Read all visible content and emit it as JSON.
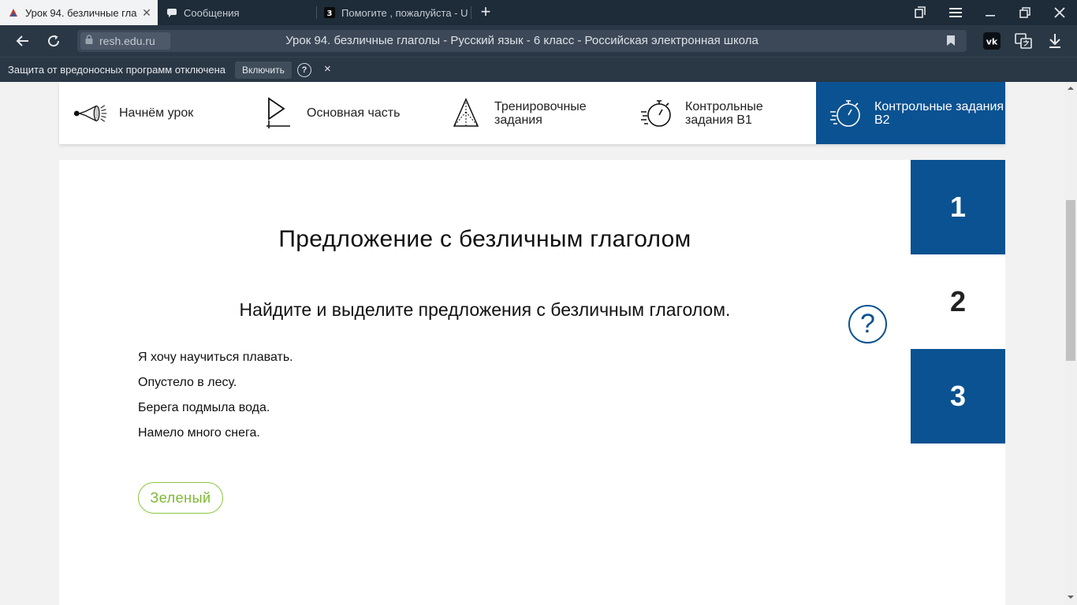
{
  "browser": {
    "tabs": [
      {
        "title": "Урок 94. безличные гла",
        "active": true,
        "icon": "resh-favicon"
      },
      {
        "title": "Сообщения",
        "active": false,
        "icon": "chat-bubble-icon"
      },
      {
        "title": "Помогите , пожалуйста - U",
        "active": false,
        "icon": "znanija-favicon"
      }
    ],
    "address": {
      "domain": "resh.edu.ru",
      "page_title": "Урок 94. безличные глаголы - Русский язык - 6 класс - Российская электронная школа"
    },
    "infobar": {
      "message": "Защита от вредоносных программ отключена",
      "button_label": "Включить",
      "help_glyph": "?",
      "close_glyph": "×"
    }
  },
  "lesson_nav": {
    "items": [
      {
        "label": "Начнём урок",
        "icon": "megaphone-icon",
        "active": false
      },
      {
        "label": "Основная часть",
        "icon": "play-icon",
        "active": false
      },
      {
        "label": "Тренировочные задания",
        "icon": "pyramid-icon",
        "active": false
      },
      {
        "label": "Контрольные задания В1",
        "icon": "stopwatch-icon",
        "active": false
      },
      {
        "label": "Контрольные задания В2",
        "icon": "stopwatch-icon",
        "active": true
      }
    ]
  },
  "task": {
    "title": "Предложение с безличным глаголом",
    "instruction": "Найдите и выделите предложения с безличным глаголом.",
    "help_glyph": "?",
    "sentences": [
      "Я хочу научиться плавать.",
      "Опустело в лесу.",
      "Берега подмыла вода.",
      "Намело много снега."
    ],
    "answer_chip": "Зеленый"
  },
  "task_tabs": [
    {
      "label": "1",
      "state": "done"
    },
    {
      "label": "2",
      "state": "current"
    },
    {
      "label": "3",
      "state": "done"
    }
  ],
  "colors": {
    "brand_blue": "#0a5291",
    "chip_green": "#8cc63f",
    "chrome_dark": "#1e2b38"
  }
}
